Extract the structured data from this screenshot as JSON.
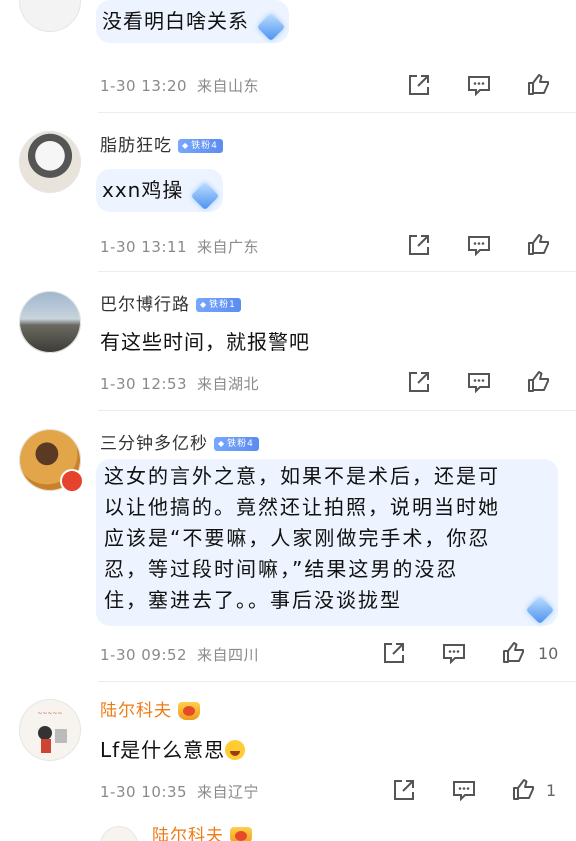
{
  "comments": [
    {
      "username": "",
      "text": "没看明白啥关系",
      "time": "1-30 13:20",
      "location": "来自山东",
      "likes": ""
    },
    {
      "username": "脂肪狂吃",
      "badge": "铁粉4",
      "text": "xxn鸡操",
      "time": "1-30 13:11",
      "location": "来自广东",
      "likes": ""
    },
    {
      "username": "巴尔博行路",
      "badge": "铁粉1",
      "text": "有这些时间，就报警吧",
      "time": "1-30 12:53",
      "location": "来自湖北",
      "likes": ""
    },
    {
      "username": "三分钟多亿秒",
      "badge": "铁粉4",
      "text_lines": [
        "这女的言外之意，如果不是术后，还是可",
        "以让他搞的。竟然还让拍照，说明当时她",
        "应该是“不要嘛，人家刚做完手术，你忍",
        "忍，等过段时间嘛，”结果这男的没忍",
        "住，塞进去了。。事后没谈拢型"
      ],
      "time": "1-30 09:52",
      "location": "来自四川",
      "likes": "10"
    },
    {
      "username": "陆尔科夫",
      "text": "Lf是什么意思",
      "time": "1-30 10:35",
      "location": "来自辽宁",
      "likes": "1"
    },
    {
      "username": "陆尔科夫"
    }
  ],
  "colors": {
    "bubble": "#edf4ff",
    "vip_name": "#f07a13",
    "meta": "#8a8a8a",
    "fan_badge": "#6b9af5"
  },
  "icons": {
    "share": "share-icon",
    "comment": "comment-icon",
    "like": "like-icon",
    "diamond": "diamond-icon",
    "crown": "crown-icon"
  }
}
